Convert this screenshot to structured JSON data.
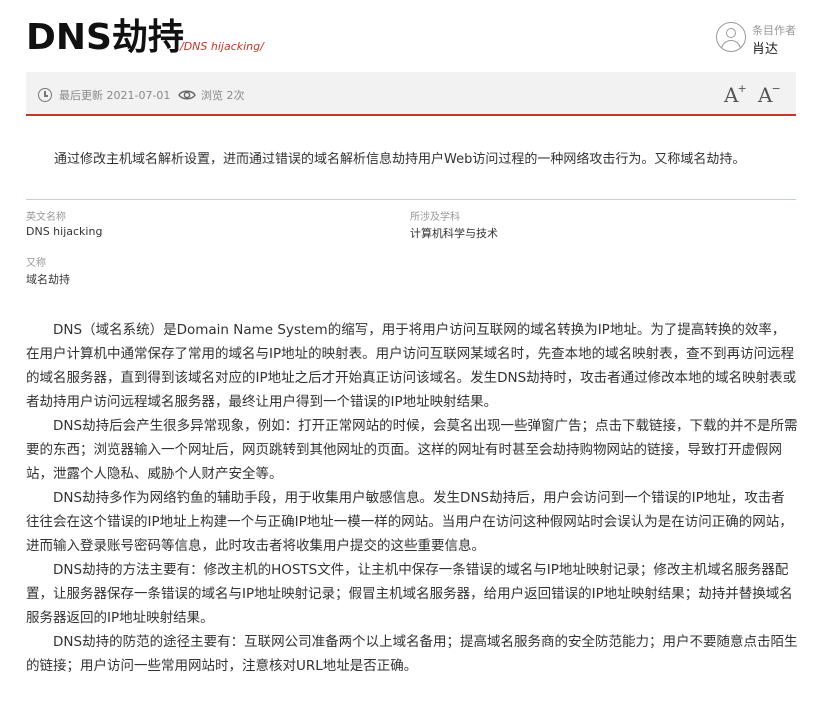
{
  "header": {
    "title": "DNS劫持",
    "title_en": "/DNS hijacking/",
    "author_label": "条目作者",
    "author_name": "肖达"
  },
  "meta": {
    "updated": "最后更新 2021-07-01",
    "views": "浏览 2次",
    "font_increase": "A",
    "font_decrease": "A"
  },
  "summary": "通过修改主机域名解析设置，进而通过错误的域名解析信息劫持用户Web访问过程的一种网络攻击行为。又称域名劫持。",
  "info": {
    "english_name_label": "英文名称",
    "english_name": "DNS hijacking",
    "subject_label": "所涉及学科",
    "subject": "计算机科学与技术",
    "alias_label": "又称",
    "alias": "域名劫持"
  },
  "content": {
    "paragraphs": [
      "DNS（域名系统）是Domain Name System的缩写，用于将用户访问互联网的域名转换为IP地址。为了提高转换的效率，在用户计算机中通常保存了常用的域名与IP地址的映射表。用户访问互联网某域名时，先查本地的域名映射表，查不到再访问远程的域名服务器，直到得到该域名对应的IP地址之后才开始真正访问该域名。发生DNS劫持时，攻击者通过修改本地的域名映射表或者劫持用户访问远程域名服务器，最终让用户得到一个错误的IP地址映射结果。",
      "DNS劫持后会产生很多异常现象，例如：打开正常网站的时候，会莫名出现一些弹窗广告；点击下载链接，下载的并不是所需要的东西；浏览器输入一个网址后，网页跳转到其他网址的页面。这样的网址有时甚至会劫持购物网站的链接，导致打开虚假网站，泄露个人隐私、威胁个人财产安全等。",
      "DNS劫持多作为网络钓鱼的辅助手段，用于收集用户敏感信息。发生DNS劫持后，用户会访问到一个错误的IP地址，攻击者往往会在这个错误的IP地址上构建一个与正确IP地址一模一样的网站。当用户在访问这种假网站时会误认为是在访问正确的网站，进而输入登录账号密码等信息，此时攻击者将收集用户提交的这些重要信息。",
      "DNS劫持的方法主要有：修改主机的HOSTS文件，让主机中保存一条错误的域名与IP地址映射记录；修改主机域名服务器配置，让服务器保存一条错误的域名与IP地址映射记录；假冒主机域名服务器，给用户返回错误的IP地址映射结果；劫持并替换域名服务器返回的IP地址映射结果。",
      "DNS劫持的防范的途径主要有：互联网公司准备两个以上域名备用；提高域名服务商的安全防范能力；用户不要随意点击陌生的链接；用户访问一些常用网站时，注意核对URL地址是否正确。"
    ]
  },
  "colors": {
    "accent": "#c0392b",
    "meta_bg": "#f2f2f2"
  }
}
